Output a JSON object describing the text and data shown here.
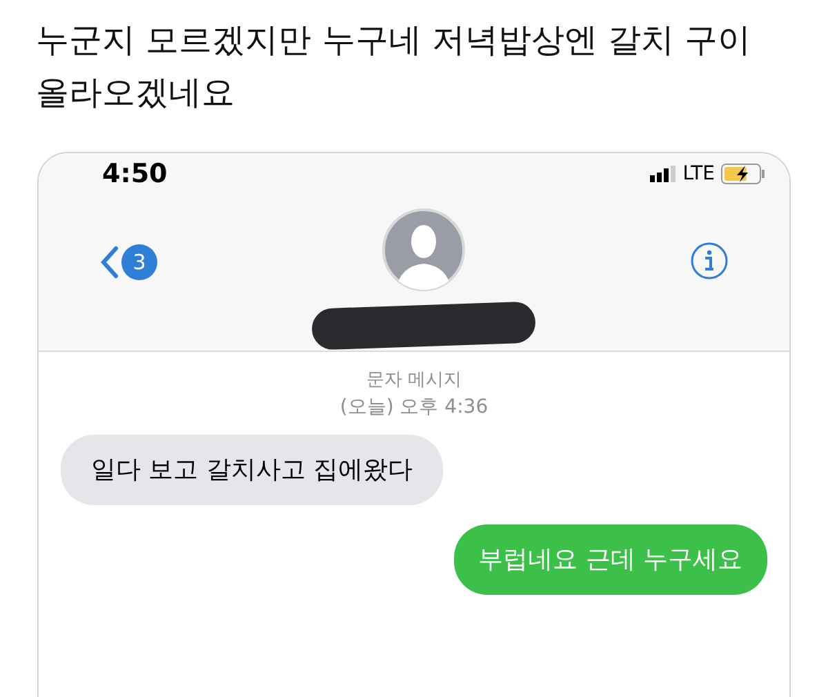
{
  "post": {
    "caption": "누군지 모르겠지만 누구네 저녁밥상엔 갈치 구이 올라오겠네요"
  },
  "status_bar": {
    "time": "4:50",
    "network": "LTE",
    "charging": true
  },
  "header": {
    "back_count": "3"
  },
  "thread": {
    "service": "문자 메시지",
    "timestamp": "(오늘) 오후 4:36"
  },
  "messages": [
    {
      "kind": "received",
      "text": "일다 보고 갈치사고 집에왔다"
    },
    {
      "kind": "sent",
      "text": "부럽네요 근데 누구세요"
    }
  ]
}
